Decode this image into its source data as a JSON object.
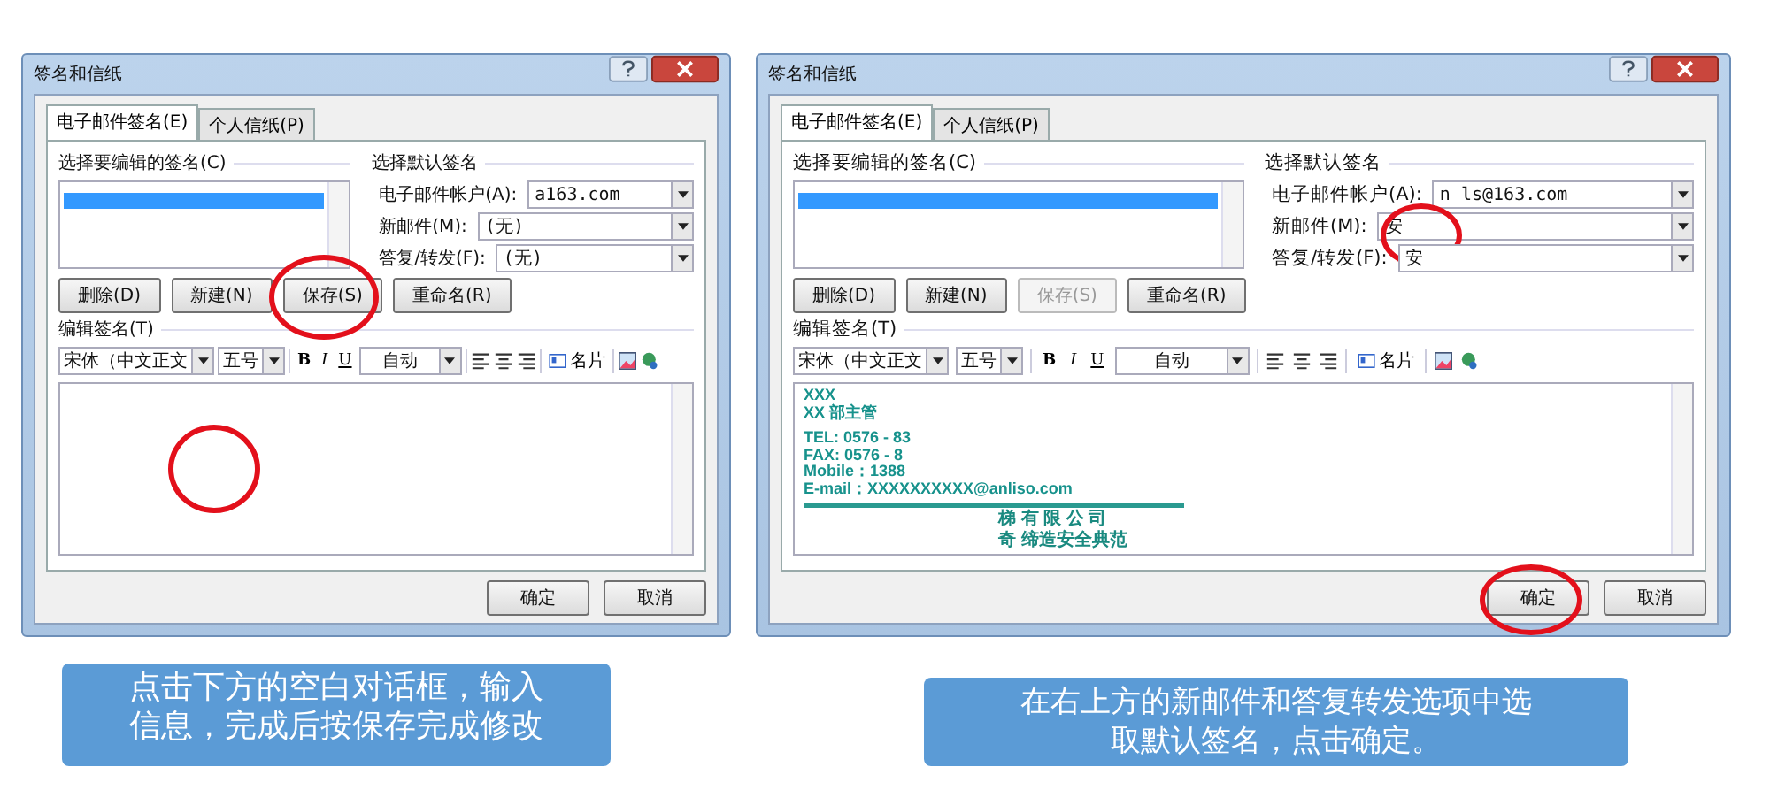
{
  "dialogs": [
    {
      "title": "签名和信纸",
      "tabs": [
        {
          "label": "电子邮件签名(E)",
          "selected": true
        },
        {
          "label": "个人信纸(P)",
          "selected": false
        }
      ],
      "list_label": "选择要编辑的签名(C)",
      "signatures": [
        {
          "selected": true
        }
      ],
      "list_buttons": [
        {
          "label": "删除(D)",
          "disabled": false,
          "circled": false
        },
        {
          "label": "新建(N)",
          "disabled": false,
          "circled": false
        },
        {
          "label": "保存(S)",
          "disabled": false,
          "circled": true
        },
        {
          "label": "重命名(R)",
          "disabled": false,
          "circled": false
        }
      ],
      "defaults_label": "选择默认签名",
      "fields": [
        {
          "label": "电子邮件帐户(A):",
          "value": "a163.com",
          "circled": false
        },
        {
          "label": "新邮件(M):",
          "value": "(无)",
          "circled": false
        },
        {
          "label": "答复/转发(F):",
          "value": "(无)",
          "circled": false
        }
      ],
      "edit_label": "编辑签名(T)",
      "toolbar": {
        "font": "宋体（中文正文",
        "size": "五号",
        "bold": "B",
        "italic": "I",
        "underline": "U",
        "auto_color": "自动",
        "card": "名片"
      },
      "editor": {
        "circled": true
      },
      "footer": [
        {
          "label": "确定",
          "circled": false
        },
        {
          "label": "取消",
          "circled": false
        }
      ]
    },
    {
      "title": "签名和信纸",
      "tabs": [
        {
          "label": "电子邮件签名(E)",
          "selected": true
        },
        {
          "label": "个人信纸(P)",
          "selected": false
        }
      ],
      "list_label": "选择要编辑的签名(C)",
      "signatures": [
        {
          "selected": true
        }
      ],
      "list_buttons": [
        {
          "label": "删除(D)",
          "disabled": false,
          "circled": false
        },
        {
          "label": "新建(N)",
          "disabled": false,
          "circled": false
        },
        {
          "label": "保存(S)",
          "disabled": true,
          "circled": false
        },
        {
          "label": "重命名(R)",
          "disabled": false,
          "circled": false
        }
      ],
      "defaults_label": "选择默认签名",
      "fields": [
        {
          "label": "电子邮件帐户(A):",
          "value": "n          ls@163.com",
          "circled": false
        },
        {
          "label": "新邮件(M):",
          "value": "安",
          "circled": true
        },
        {
          "label": "答复/转发(F):",
          "value": "安",
          "circled": false
        }
      ],
      "edit_label": "编辑签名(T)",
      "toolbar": {
        "font": "宋体（中文正文",
        "size": "五号",
        "bold": "B",
        "italic": "I",
        "underline": "U",
        "auto_color": "自动",
        "card": "名片"
      },
      "editor": {
        "circled": false,
        "lines": [
          {
            "kind": "text",
            "text": "XXX"
          },
          {
            "kind": "text",
            "text": "XX 部主管"
          },
          {
            "kind": "gap"
          },
          {
            "kind": "text",
            "text": "TEL: 0576 - 83"
          },
          {
            "kind": "text",
            "text": "FAX: 0576 - 8"
          },
          {
            "kind": "text",
            "text": "Mobile：1388"
          },
          {
            "kind": "text",
            "text": "E-mail：XXXXXXXXXX@anliso.com"
          },
          {
            "kind": "rule"
          },
          {
            "kind": "title",
            "text": "梯 有 限 公 司"
          },
          {
            "kind": "title",
            "text": "奇  缔造安全典范"
          }
        ]
      },
      "footer": [
        {
          "label": "确定",
          "circled": true
        },
        {
          "label": "取消",
          "circled": false
        }
      ]
    }
  ],
  "captions": [
    {
      "lines": [
        "点击下方的空白对话框，输入",
        "信息，完成后按保存完成修改"
      ]
    },
    {
      "lines": [
        "在右上方的新邮件和答复转发选项中选",
        "取默认签名，点击确定。"
      ]
    }
  ]
}
